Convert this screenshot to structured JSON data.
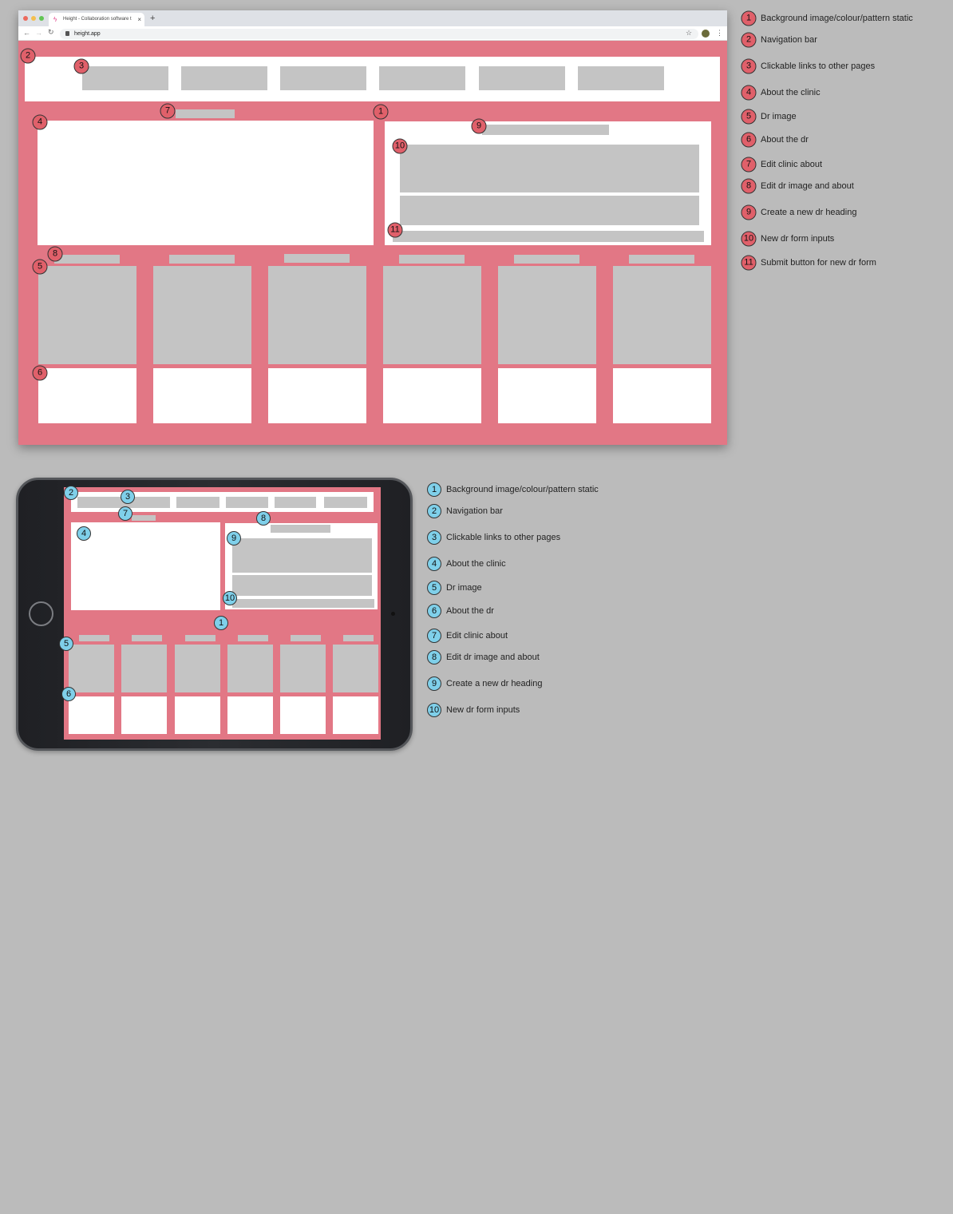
{
  "browser": {
    "tab_title": "Height - Collaboration software t",
    "url": "height.app",
    "new_tab": "+",
    "close_tab": "×"
  },
  "colors": {
    "page_bg": "#e27785",
    "desktop_badge": "#e0606a",
    "tablet_badge": "#7fd0ea",
    "placeholder": "#c4c4c4",
    "canvas": "#bbbbbb"
  },
  "desktop_legend": [
    {
      "n": "1",
      "label": "Background image/colour/pattern static"
    },
    {
      "n": "2",
      "label": "Navigation bar"
    },
    {
      "n": "3",
      "label": "Clickable links to other pages"
    },
    {
      "n": "4",
      "label": "About the clinic"
    },
    {
      "n": "5",
      "label": "Dr image"
    },
    {
      "n": "6",
      "label": "About the dr"
    },
    {
      "n": "7",
      "label": "Edit clinic about"
    },
    {
      "n": "8",
      "label": "Edit dr image and about"
    },
    {
      "n": "9",
      "label": "Create a new dr heading"
    },
    {
      "n": "10",
      "label": "New dr form inputs"
    },
    {
      "n": "11",
      "label": "Submit button for new dr form"
    }
  ],
  "tablet_legend": [
    {
      "n": "1",
      "label": "Background image/colour/pattern static"
    },
    {
      "n": "2",
      "label": "Navigation bar"
    },
    {
      "n": "3",
      "label": "Clickable links to other pages"
    },
    {
      "n": "4",
      "label": "About the clinic"
    },
    {
      "n": "5",
      "label": "Dr image"
    },
    {
      "n": "6",
      "label": "About the dr"
    },
    {
      "n": "7",
      "label": "Edit clinic about"
    },
    {
      "n": "8",
      "label": "Edit dr image and about"
    },
    {
      "n": "9",
      "label": "Create a new dr heading"
    },
    {
      "n": "10",
      "label": "New dr form inputs"
    }
  ],
  "desktop_badges": [
    "1",
    "2",
    "3",
    "4",
    "5",
    "6",
    "7",
    "8",
    "9",
    "10",
    "11"
  ],
  "tablet_badges": [
    "1",
    "2",
    "3",
    "4",
    "5",
    "6",
    "7",
    "8",
    "9",
    "10"
  ]
}
